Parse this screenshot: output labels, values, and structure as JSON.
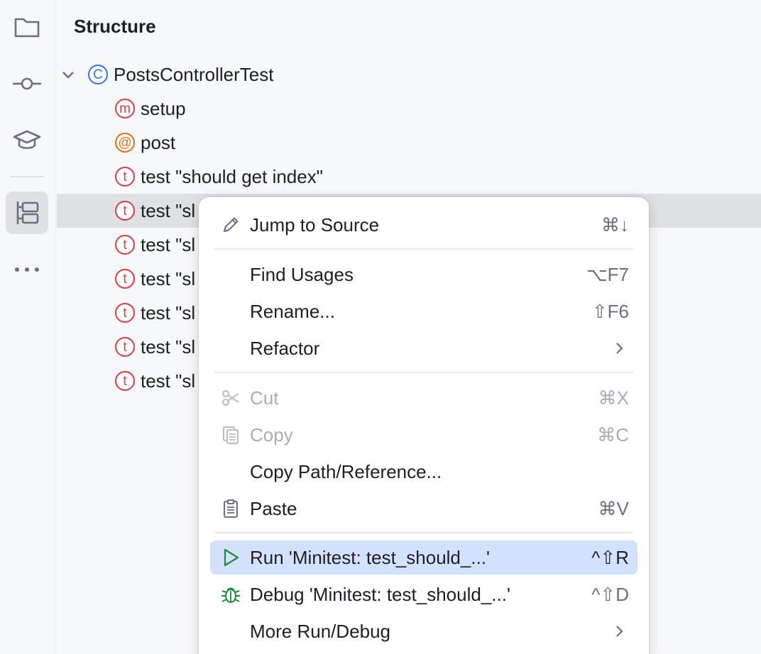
{
  "toolstrip": {
    "items": [
      {
        "name": "project-folder-icon"
      },
      {
        "name": "commit-icon"
      },
      {
        "name": "learn-icon"
      },
      {
        "name": "structure-icon",
        "active": true
      },
      {
        "name": "more-icon"
      }
    ]
  },
  "panel": {
    "title": "Structure",
    "root": {
      "icon_letter": "C",
      "label": "PostsControllerTest",
      "icon_color": "#3574f0"
    },
    "children": [
      {
        "icon_letter": "m",
        "label": "setup",
        "icon_color": "#db3b4b"
      },
      {
        "icon_letter": "@",
        "label": "post",
        "icon_color": "#e66d17"
      },
      {
        "icon_letter": "t",
        "label": "test \"should get index\"",
        "icon_color": "#db3b4b"
      },
      {
        "icon_letter": "t",
        "label": "test \"sl",
        "icon_color": "#db3b4b",
        "selected": true
      },
      {
        "icon_letter": "t",
        "label": "test \"sl",
        "icon_color": "#db3b4b"
      },
      {
        "icon_letter": "t",
        "label": "test \"sl",
        "icon_color": "#db3b4b"
      },
      {
        "icon_letter": "t",
        "label": "test \"sl",
        "icon_color": "#db3b4b"
      },
      {
        "icon_letter": "t",
        "label": "test \"sl",
        "icon_color": "#db3b4b"
      },
      {
        "icon_letter": "t",
        "label": "test \"sl",
        "icon_color": "#db3b4b"
      }
    ]
  },
  "context_menu": {
    "items": [
      {
        "label": "Jump to Source",
        "shortcut": "⌘↓",
        "icon": "pencil-icon"
      },
      {
        "label": "Find Usages",
        "shortcut": "⌥F7"
      },
      {
        "label": "Rename...",
        "shortcut": "⇧F6"
      },
      {
        "label": "Refactor",
        "submenu": true
      },
      {
        "label": "Cut",
        "shortcut": "⌘X",
        "icon": "scissors-icon",
        "disabled": true
      },
      {
        "label": "Copy",
        "shortcut": "⌘C",
        "icon": "copy-icon",
        "disabled": true
      },
      {
        "label": "Copy Path/Reference..."
      },
      {
        "label": "Paste",
        "shortcut": "⌘V",
        "icon": "clipboard-icon"
      },
      {
        "label": "Run 'Minitest: test_should_...'",
        "shortcut": "^⇧R",
        "icon": "run-icon",
        "highlighted": true
      },
      {
        "label": "Debug 'Minitest: test_should_...'",
        "shortcut": "^⇧D",
        "icon": "debug-icon"
      },
      {
        "label": "More Run/Debug",
        "submenu": true
      }
    ]
  },
  "colors": {
    "accent": "#3574f0",
    "run_green": "#208a3c",
    "highlight": "#d4e2ff",
    "selection": "#dfe1e5"
  }
}
